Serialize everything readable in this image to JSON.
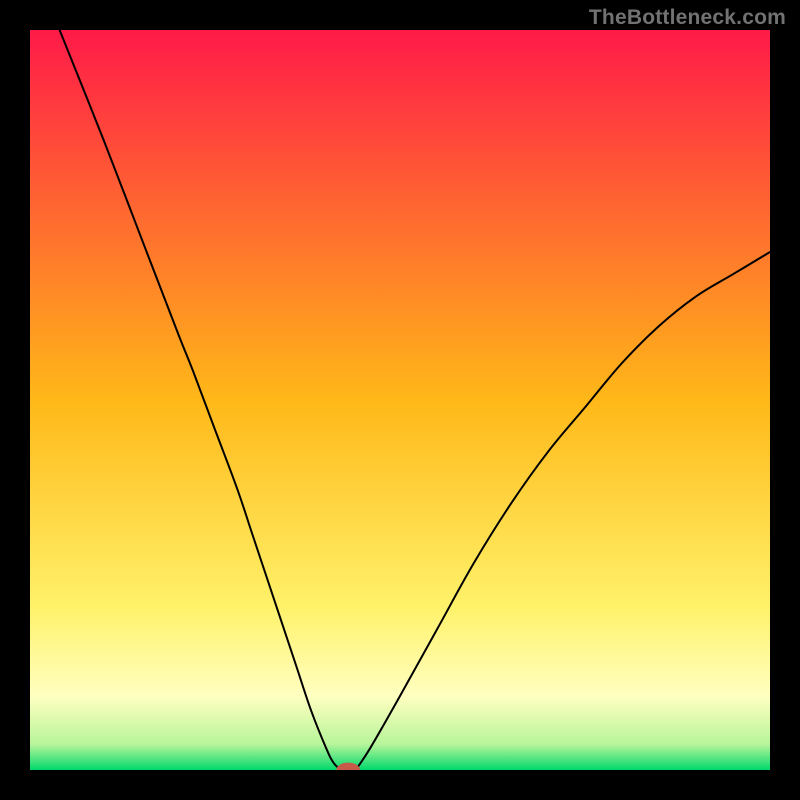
{
  "watermark": {
    "text": "TheBottleneck.com"
  },
  "chart_data": {
    "type": "line",
    "title": "",
    "xlabel": "",
    "ylabel": "",
    "xlim": [
      0,
      100
    ],
    "ylim": [
      0,
      100
    ],
    "grid": false,
    "legend": false,
    "background": "gradient",
    "gradient_stops": [
      {
        "offset": 0.0,
        "color": "#ff1a48"
      },
      {
        "offset": 0.5,
        "color": "#ffb818"
      },
      {
        "offset": 0.78,
        "color": "#fff26a"
      },
      {
        "offset": 0.9,
        "color": "#ffffc0"
      },
      {
        "offset": 0.965,
        "color": "#b8f59a"
      },
      {
        "offset": 1.0,
        "color": "#00d96c"
      }
    ],
    "series": [
      {
        "name": "left-branch",
        "x": [
          4,
          10,
          15,
          20,
          22,
          25,
          28,
          30,
          32,
          34,
          36,
          38,
          40,
          41,
          42
        ],
        "values": [
          100,
          85,
          72,
          59,
          54,
          46,
          38,
          32,
          26,
          20,
          14,
          8,
          3,
          1,
          0
        ]
      },
      {
        "name": "right-branch",
        "x": [
          44,
          46,
          50,
          55,
          60,
          65,
          70,
          75,
          80,
          85,
          90,
          95,
          100
        ],
        "values": [
          0,
          3,
          10,
          19,
          28,
          36,
          43,
          49,
          55,
          60,
          64,
          67,
          70
        ]
      }
    ],
    "marker": {
      "name": "bottleneck-marker",
      "x": 43,
      "y": 0,
      "rx": 1.6,
      "ry": 1.0,
      "color": "#c85a4a"
    },
    "frame_stroke": "#000000",
    "curve_stroke": "#000000",
    "curve_width": 2
  }
}
